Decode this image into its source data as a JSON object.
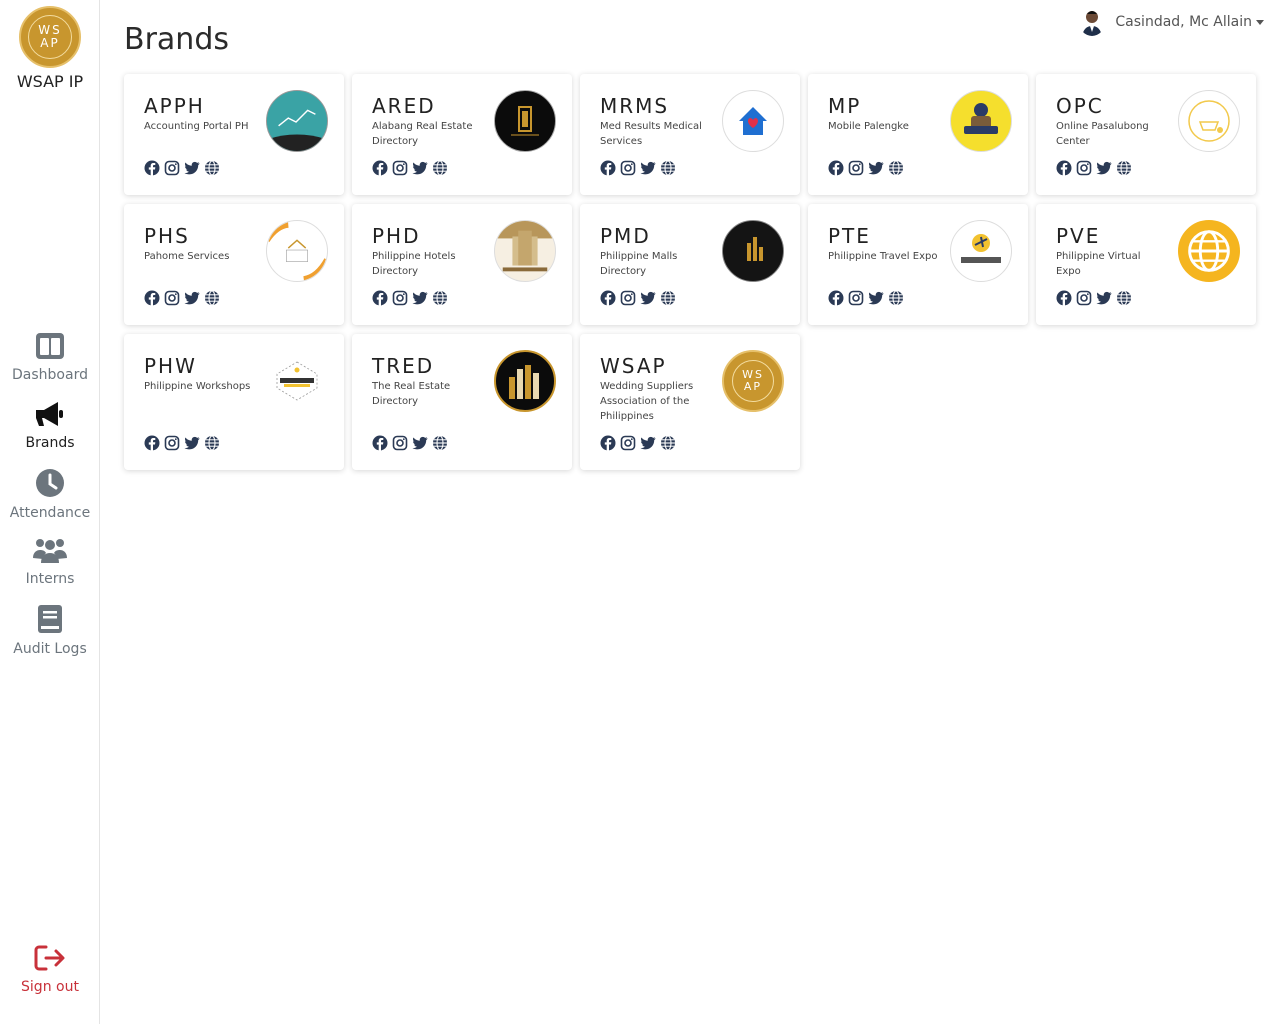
{
  "app": {
    "name": "WSAP IP",
    "logo_text_top": "WS",
    "logo_text_bottom": "AP"
  },
  "user": {
    "name": "Casindad, Mc Allain"
  },
  "page": {
    "title": "Brands"
  },
  "nav": {
    "dashboard": "Dashboard",
    "brands": "Brands",
    "attendance": "Attendance",
    "interns": "Interns",
    "audit_logs": "Audit Logs",
    "sign_out": "Sign out"
  },
  "colors": {
    "accent": "#c8962e",
    "icon_blue": "#2b3a55",
    "signout": "#c8313a"
  },
  "brands": [
    {
      "code": "APPH",
      "name": "Accounting Portal PH"
    },
    {
      "code": "ARED",
      "name": "Alabang Real Estate Directory"
    },
    {
      "code": "MRMS",
      "name": "Med Results Medical Services"
    },
    {
      "code": "MP",
      "name": "Mobile Palengke"
    },
    {
      "code": "OPC",
      "name": "Online Pasalubong Center"
    },
    {
      "code": "PHS",
      "name": "Pahome Services"
    },
    {
      "code": "PHD",
      "name": "Philippine Hotels Directory"
    },
    {
      "code": "PMD",
      "name": "Philippine Malls Directory"
    },
    {
      "code": "PTE",
      "name": "Philippine Travel Expo"
    },
    {
      "code": "PVE",
      "name": "Philippine Virtual Expo"
    },
    {
      "code": "PHW",
      "name": "Philippine Workshops"
    },
    {
      "code": "TRED",
      "name": "The Real Estate Directory"
    },
    {
      "code": "WSAP",
      "name": "Wedding Suppliers Association of the Philippines"
    }
  ],
  "social_icons": [
    "facebook-icon",
    "instagram-icon",
    "twitter-icon",
    "globe-icon"
  ]
}
